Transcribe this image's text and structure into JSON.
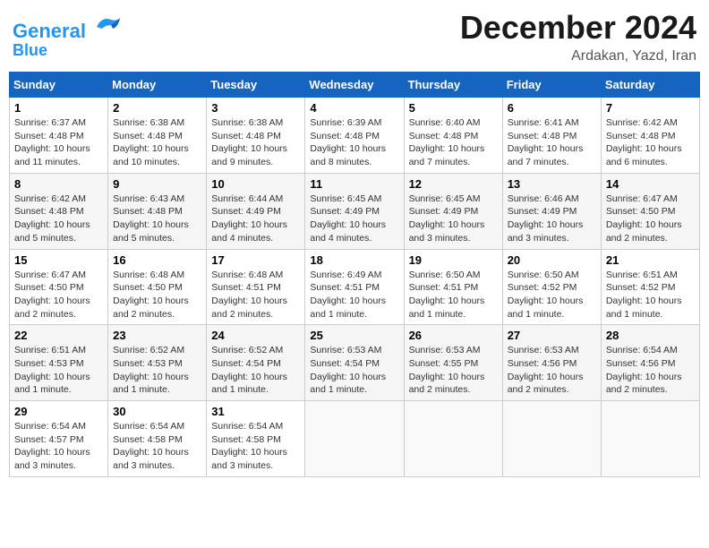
{
  "header": {
    "logo_line1": "General",
    "logo_line2": "Blue",
    "main_title": "December 2024",
    "subtitle": "Ardakan, Yazd, Iran"
  },
  "calendar": {
    "days_of_week": [
      "Sunday",
      "Monday",
      "Tuesday",
      "Wednesday",
      "Thursday",
      "Friday",
      "Saturday"
    ],
    "weeks": [
      [
        null,
        {
          "day": "2",
          "sunrise": "6:38 AM",
          "sunset": "4:48 PM",
          "daylight": "10 hours and 10 minutes."
        },
        {
          "day": "3",
          "sunrise": "6:38 AM",
          "sunset": "4:48 PM",
          "daylight": "10 hours and 9 minutes."
        },
        {
          "day": "4",
          "sunrise": "6:39 AM",
          "sunset": "4:48 PM",
          "daylight": "10 hours and 8 minutes."
        },
        {
          "day": "5",
          "sunrise": "6:40 AM",
          "sunset": "4:48 PM",
          "daylight": "10 hours and 7 minutes."
        },
        {
          "day": "6",
          "sunrise": "6:41 AM",
          "sunset": "4:48 PM",
          "daylight": "10 hours and 7 minutes."
        },
        {
          "day": "7",
          "sunrise": "6:42 AM",
          "sunset": "4:48 PM",
          "daylight": "10 hours and 6 minutes."
        }
      ],
      [
        {
          "day": "1",
          "sunrise": "6:37 AM",
          "sunset": "4:48 PM",
          "daylight": "10 hours and 11 minutes."
        },
        null,
        null,
        null,
        null,
        null,
        null
      ],
      [
        {
          "day": "8",
          "sunrise": "6:42 AM",
          "sunset": "4:48 PM",
          "daylight": "10 hours and 5 minutes."
        },
        {
          "day": "9",
          "sunrise": "6:43 AM",
          "sunset": "4:48 PM",
          "daylight": "10 hours and 5 minutes."
        },
        {
          "day": "10",
          "sunrise": "6:44 AM",
          "sunset": "4:49 PM",
          "daylight": "10 hours and 4 minutes."
        },
        {
          "day": "11",
          "sunrise": "6:45 AM",
          "sunset": "4:49 PM",
          "daylight": "10 hours and 4 minutes."
        },
        {
          "day": "12",
          "sunrise": "6:45 AM",
          "sunset": "4:49 PM",
          "daylight": "10 hours and 3 minutes."
        },
        {
          "day": "13",
          "sunrise": "6:46 AM",
          "sunset": "4:49 PM",
          "daylight": "10 hours and 3 minutes."
        },
        {
          "day": "14",
          "sunrise": "6:47 AM",
          "sunset": "4:50 PM",
          "daylight": "10 hours and 2 minutes."
        }
      ],
      [
        {
          "day": "15",
          "sunrise": "6:47 AM",
          "sunset": "4:50 PM",
          "daylight": "10 hours and 2 minutes."
        },
        {
          "day": "16",
          "sunrise": "6:48 AM",
          "sunset": "4:50 PM",
          "daylight": "10 hours and 2 minutes."
        },
        {
          "day": "17",
          "sunrise": "6:48 AM",
          "sunset": "4:51 PM",
          "daylight": "10 hours and 2 minutes."
        },
        {
          "day": "18",
          "sunrise": "6:49 AM",
          "sunset": "4:51 PM",
          "daylight": "10 hours and 1 minute."
        },
        {
          "day": "19",
          "sunrise": "6:50 AM",
          "sunset": "4:51 PM",
          "daylight": "10 hours and 1 minute."
        },
        {
          "day": "20",
          "sunrise": "6:50 AM",
          "sunset": "4:52 PM",
          "daylight": "10 hours and 1 minute."
        },
        {
          "day": "21",
          "sunrise": "6:51 AM",
          "sunset": "4:52 PM",
          "daylight": "10 hours and 1 minute."
        }
      ],
      [
        {
          "day": "22",
          "sunrise": "6:51 AM",
          "sunset": "4:53 PM",
          "daylight": "10 hours and 1 minute."
        },
        {
          "day": "23",
          "sunrise": "6:52 AM",
          "sunset": "4:53 PM",
          "daylight": "10 hours and 1 minute."
        },
        {
          "day": "24",
          "sunrise": "6:52 AM",
          "sunset": "4:54 PM",
          "daylight": "10 hours and 1 minute."
        },
        {
          "day": "25",
          "sunrise": "6:53 AM",
          "sunset": "4:54 PM",
          "daylight": "10 hours and 1 minute."
        },
        {
          "day": "26",
          "sunrise": "6:53 AM",
          "sunset": "4:55 PM",
          "daylight": "10 hours and 2 minutes."
        },
        {
          "day": "27",
          "sunrise": "6:53 AM",
          "sunset": "4:56 PM",
          "daylight": "10 hours and 2 minutes."
        },
        {
          "day": "28",
          "sunrise": "6:54 AM",
          "sunset": "4:56 PM",
          "daylight": "10 hours and 2 minutes."
        }
      ],
      [
        {
          "day": "29",
          "sunrise": "6:54 AM",
          "sunset": "4:57 PM",
          "daylight": "10 hours and 3 minutes."
        },
        {
          "day": "30",
          "sunrise": "6:54 AM",
          "sunset": "4:58 PM",
          "daylight": "10 hours and 3 minutes."
        },
        {
          "day": "31",
          "sunrise": "6:54 AM",
          "sunset": "4:58 PM",
          "daylight": "10 hours and 3 minutes."
        },
        null,
        null,
        null,
        null
      ]
    ]
  }
}
